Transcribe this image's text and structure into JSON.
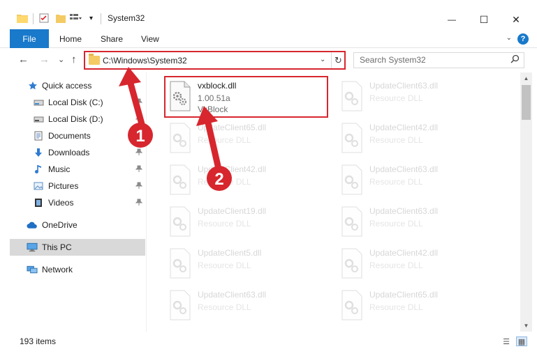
{
  "window": {
    "title": "System32",
    "minimize_glyph": "—",
    "maximize_glyph": "☐",
    "close_glyph": "✕"
  },
  "ribbon": {
    "tabs": [
      "File",
      "Home",
      "Share",
      "View"
    ],
    "expand_glyph": "⌄",
    "help_glyph": "?"
  },
  "address": {
    "path": "C:\\Windows\\System32",
    "dropdown_glyph": "⌄",
    "refresh_glyph": "↻",
    "back_glyph": "←",
    "forward_glyph": "→",
    "recent_glyph": "⌄",
    "up_glyph": "↑"
  },
  "search": {
    "placeholder": "Search System32",
    "icon": "search-icon"
  },
  "sidebar": {
    "items": [
      {
        "label": "Quick access",
        "icon": "star-icon"
      },
      {
        "label": "Local Disk (C:)",
        "icon": "drive-icon"
      },
      {
        "label": "Local Disk (D:)",
        "icon": "drive-icon"
      },
      {
        "label": "Documents",
        "icon": "documents-icon"
      },
      {
        "label": "Downloads",
        "icon": "downloads-icon"
      },
      {
        "label": "Music",
        "icon": "music-icon"
      },
      {
        "label": "Pictures",
        "icon": "pictures-icon"
      },
      {
        "label": "Videos",
        "icon": "videos-icon"
      },
      {
        "label": "OneDrive",
        "icon": "cloud-icon"
      },
      {
        "label": "This PC",
        "icon": "computer-icon"
      },
      {
        "label": "Network",
        "icon": "network-icon"
      }
    ],
    "pin_glyph": "📌"
  },
  "files": {
    "highlighted": {
      "name": "vxblock.dll",
      "version": "1.00.51a",
      "description": "VxBlock"
    },
    "items": [
      {
        "name": "UpdateClient63.dll",
        "type": "Resource DLL"
      },
      {
        "name": "UpdateClient65.dll",
        "type": "Resource DLL"
      },
      {
        "name": "UpdateClient42.dll",
        "type": "Resource DLL"
      },
      {
        "name": "UpdateClient42.dll",
        "type": "Resource DLL"
      },
      {
        "name": "UpdateClient63.dll",
        "type": "Resource DLL"
      },
      {
        "name": "UpdateClient19.dll",
        "type": "Resource DLL"
      },
      {
        "name": "UpdateClient63.dll",
        "type": "Resource DLL"
      },
      {
        "name": "UpdateClient5.dll",
        "type": "Resource DLL"
      },
      {
        "name": "UpdateClient42.dll",
        "type": "Resource DLL"
      },
      {
        "name": "UpdateClient63.dll",
        "type": "Resource DLL"
      },
      {
        "name": "UpdateClient65.dll",
        "type": "Resource DLL"
      }
    ]
  },
  "annotations": {
    "step1": "1",
    "step2": "2"
  },
  "status": {
    "item_count": "193 items"
  },
  "colors": {
    "accent": "#1979ca",
    "highlight": "#d7262e",
    "selected": "#d9d9d9"
  }
}
